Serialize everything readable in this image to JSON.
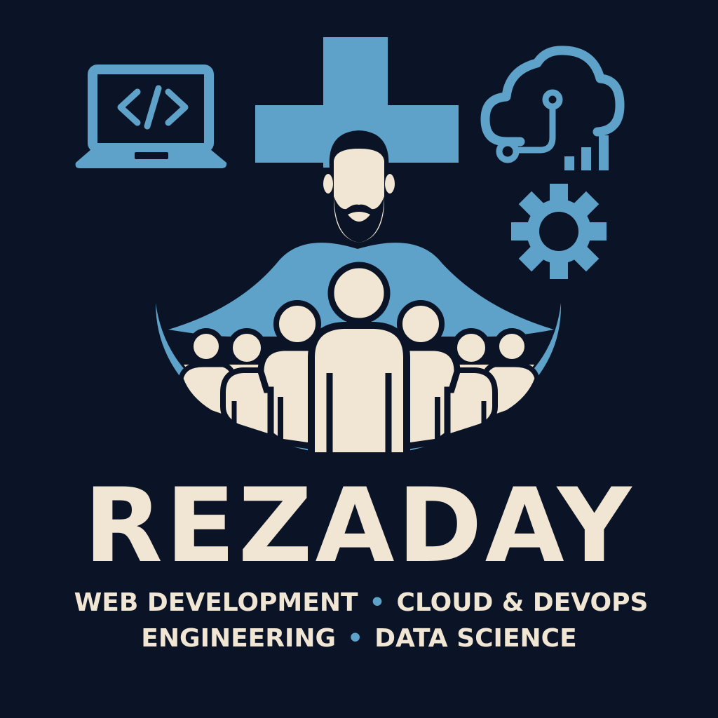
{
  "brand": {
    "name": "REZADAY",
    "tagline_line1": {
      "left": "WEB DEVELOPMENT",
      "separator": "•",
      "right": "CLOUD & DEVOPS"
    },
    "tagline_line2": {
      "left": "ENGINEERING",
      "separator": "•",
      "right": "DATA SCIENCE"
    }
  },
  "icons": [
    "laptop-code-icon",
    "cross-icon",
    "cloud-network-icon",
    "bar-chart-icon",
    "gear-icon",
    "leader-person-icon",
    "people-group-icon"
  ],
  "colors": {
    "background": "#0b1426",
    "accent_blue": "#5ea1c9",
    "cream": "#f1e6d4"
  }
}
